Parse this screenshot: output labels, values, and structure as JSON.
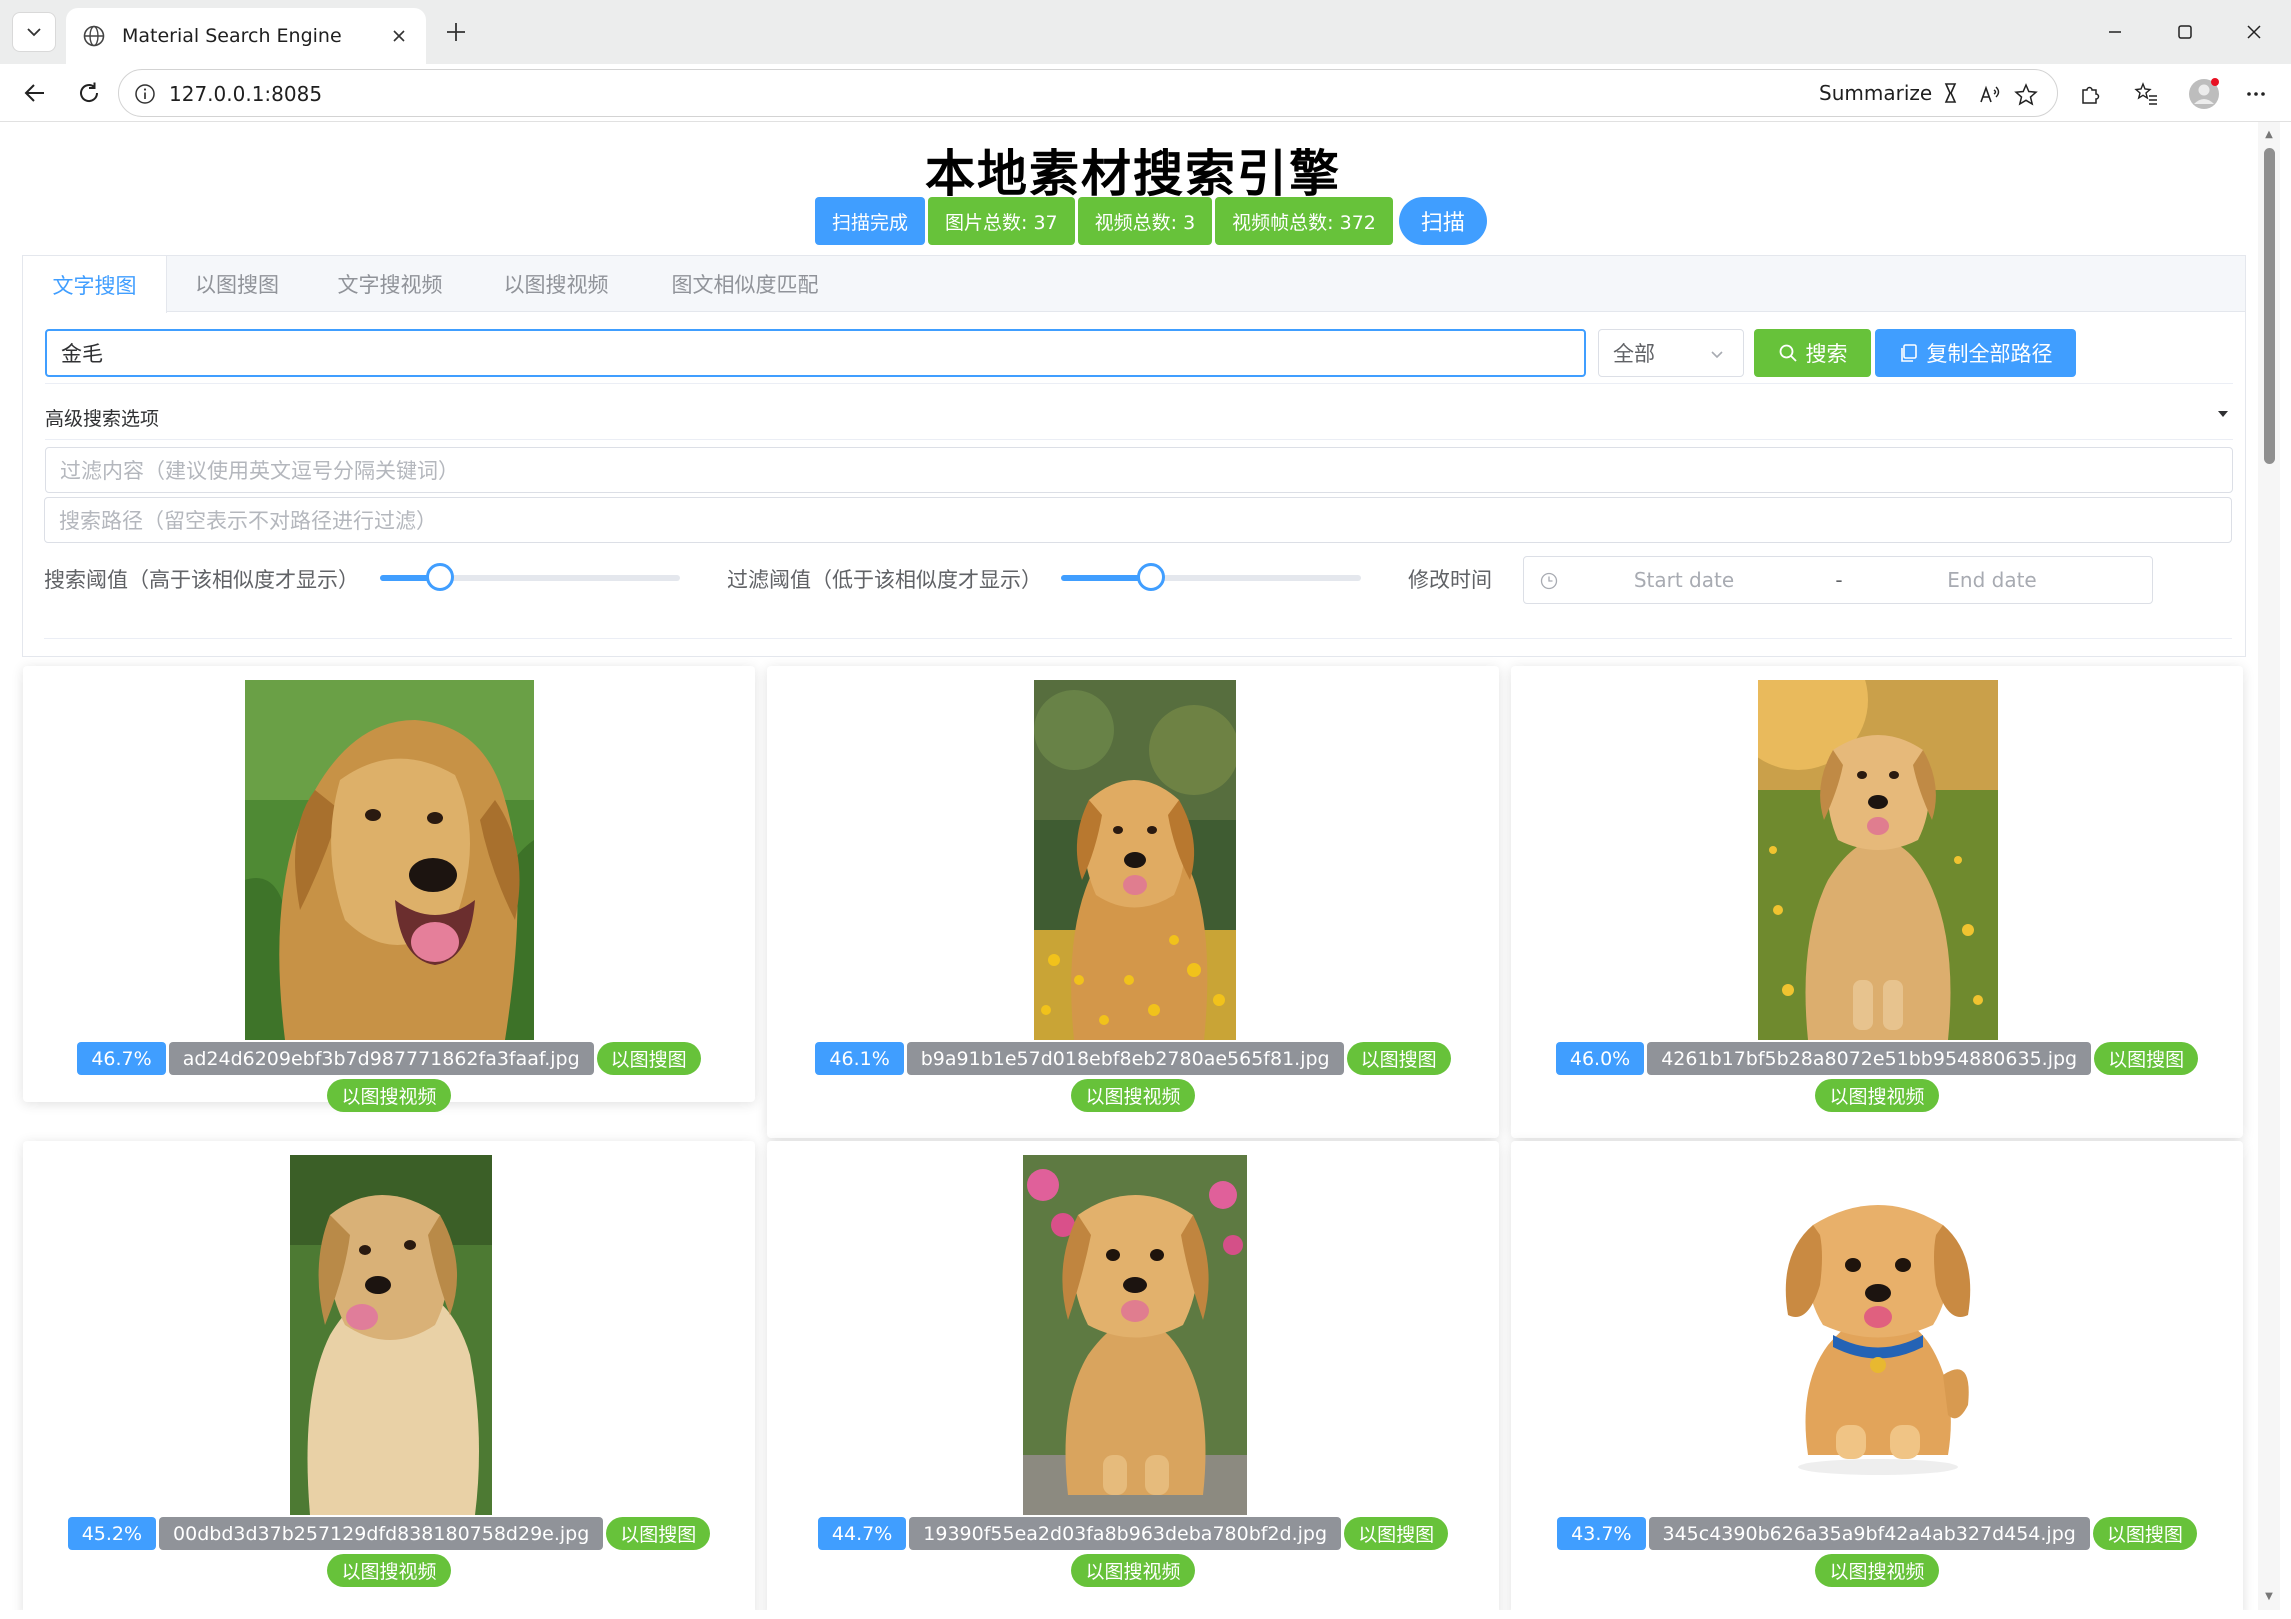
{
  "browser": {
    "tab_title": "Material Search Engine",
    "url": "127.0.0.1:8085",
    "summarize_label": "Summarize"
  },
  "page": {
    "title": "本地素材搜索引擎",
    "status": {
      "scan_done": "扫描完成",
      "image_total": "图片总数: 37",
      "video_total": "视频总数: 3",
      "frame_total": "视频帧总数: 372",
      "scan_button": "扫描"
    },
    "tabs": [
      "文字搜图",
      "以图搜图",
      "文字搜视频",
      "以图搜视频",
      "图文相似度匹配"
    ],
    "search": {
      "query": "金毛",
      "scope": "全部",
      "search_button": "搜索",
      "copy_button": "复制全部路径"
    },
    "advanced": {
      "title": "高级搜索选项",
      "filter_placeholder": "过滤内容（建议使用英文逗号分隔关键词）",
      "path_placeholder": "搜索路径（留空表示不对路径进行过滤）",
      "search_threshold_label": "搜索阈值（高于该相似度才显示）",
      "search_threshold_value": 0.2,
      "filter_threshold_label": "过滤阈值（低于该相似度才显示）",
      "filter_threshold_value": 0.3,
      "modified_time_label": "修改时间",
      "start_date_placeholder": "Start date",
      "date_separator": "-",
      "end_date_placeholder": "End date"
    }
  },
  "results": [
    {
      "score": "46.7%",
      "filename": "ad24d6209ebf3b7d987771862fa3faaf.jpg",
      "action_image": "以图搜图",
      "action_video": "以图搜视频"
    },
    {
      "score": "46.1%",
      "filename": "b9a91b1e57d018ebf8eb2780ae565f81.jpg",
      "action_image": "以图搜图",
      "action_video": "以图搜视频"
    },
    {
      "score": "46.0%",
      "filename": "4261b17bf5b28a8072e51bb954880635.jpg",
      "action_image": "以图搜图",
      "action_video": "以图搜视频"
    },
    {
      "score": "45.2%",
      "filename": "00dbd3d37b257129dfd838180758d29e.jpg",
      "action_image": "以图搜图",
      "action_video": "以图搜视频"
    },
    {
      "score": "44.7%",
      "filename": "19390f55ea2d03fa8b963deba780bf2d.jpg",
      "action_image": "以图搜图",
      "action_video": "以图搜视频"
    },
    {
      "score": "43.7%",
      "filename": "345c4390b626a35a9bf42a4ab327d454.jpg",
      "action_image": "以图搜图",
      "action_video": "以图搜视频"
    }
  ],
  "colors": {
    "primary": "#409eff",
    "success": "#67c23a",
    "info": "#909399"
  }
}
